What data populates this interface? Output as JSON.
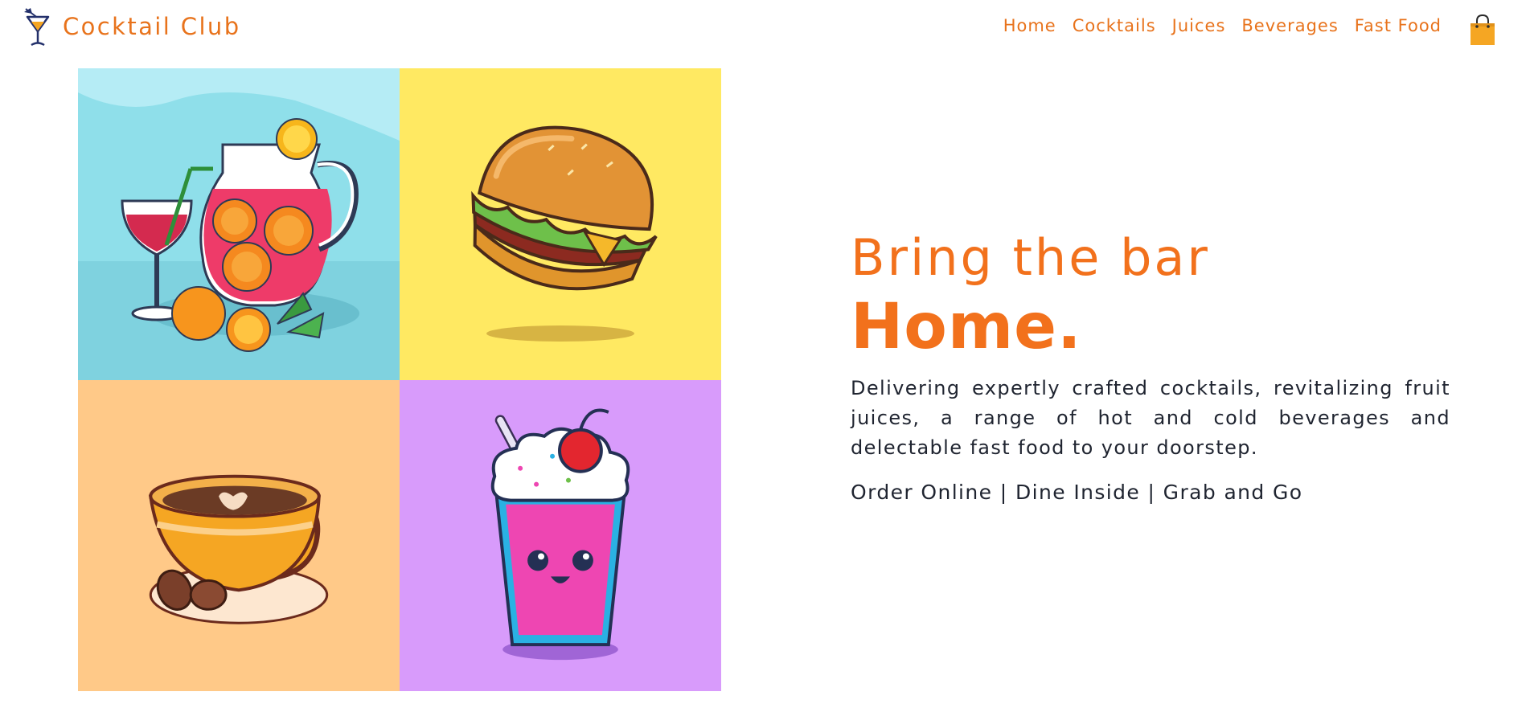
{
  "brand": {
    "name": "Cocktail Club",
    "logo_icon": "cocktail-glass-icon"
  },
  "nav": {
    "items": [
      "Home",
      "Cocktails",
      "Juices",
      "Beverages",
      "Fast Food"
    ],
    "cart_icon": "shopping-bag-icon"
  },
  "hero": {
    "heading_line1": "Bring the bar",
    "heading_line2": "Home.",
    "description": "Delivering expertly crafted cocktails, revitalizing fruit juices, a range of hot and cold beverages and delectable fast food to your doorstep.",
    "services": "Order Online | Dine Inside | Grab and Go"
  },
  "gallery": {
    "tiles": [
      {
        "icon": "pitcher-and-glass-icon",
        "background": "#8fdfea"
      },
      {
        "icon": "burger-icon",
        "background": "#ffe962"
      },
      {
        "icon": "coffee-cup-icon",
        "background": "#ffc988"
      },
      {
        "icon": "milkshake-icon",
        "background": "#d89bfb"
      }
    ]
  },
  "colors": {
    "accent": "#f2711c",
    "text": "#1f2430",
    "cart": "#f5a623"
  }
}
